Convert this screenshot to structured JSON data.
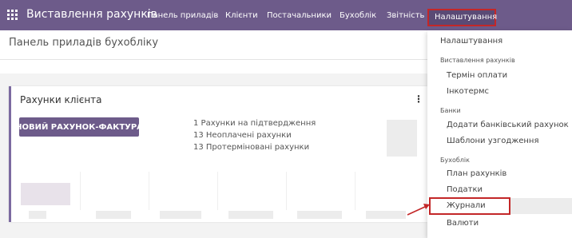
{
  "topbar": {
    "app_title": "Виставлення рахунків",
    "menu": [
      {
        "label": "Панель приладів"
      },
      {
        "label": "Клієнти"
      },
      {
        "label": "Постачальники"
      },
      {
        "label": "Бухоблік"
      },
      {
        "label": "Звітність"
      }
    ],
    "active_menu": "Налаштування"
  },
  "page": {
    "title": "Панель приладів бухобліку"
  },
  "card": {
    "title": "Рахунки клієнта",
    "new_invoice_button": "НОВИЙ РАХУНОК-ФАКТУРА",
    "stats": [
      "1 Рахунки на підтвердження",
      "13 Неоплачені рахунки",
      "13 Протерміновані рахунки"
    ]
  },
  "dropdown": {
    "settings": "Налаштування",
    "section_invoicing": "Виставлення рахунків",
    "payment_terms": "Термін оплати",
    "incoterms": "Інкотермс",
    "section_banks": "Банки",
    "add_bank_account": "Додати банківський рахунок",
    "reconciliation_models": "Шаблони узгодження",
    "section_accounting": "Бухоблік",
    "chart_of_accounts": "План рахунків",
    "taxes": "Податки",
    "journals": "Журнали",
    "currencies": "Валюти"
  },
  "colors": {
    "brand": "#6d5b8a",
    "highlight_red": "#c32728"
  }
}
